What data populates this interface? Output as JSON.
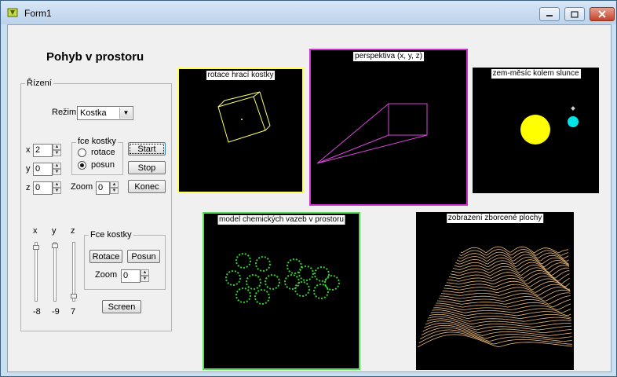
{
  "window": {
    "title": "Form1"
  },
  "heading": "Pohyb v prostoru",
  "rizeni": {
    "label": "Řízení",
    "rezim_label": "Režim",
    "rezim_value": "Kostka",
    "x_label": "x",
    "x_value": "2",
    "y_label": "y",
    "y_value": "0",
    "z_label": "z",
    "z_value": "0",
    "fce_label": "fce kostky",
    "radio_rotace": "rotace",
    "radio_posun": "posun",
    "radio_selected": "posun",
    "start_label": "Start",
    "stop_label": "Stop",
    "konec_label": "Konec",
    "zoom_label": "Zoom",
    "zoom_value": "0"
  },
  "sliders": {
    "x_label": "x",
    "y_label": "y",
    "z_label": "z",
    "x_value": "-8",
    "y_value": "-9",
    "z_value": "7"
  },
  "fce_kostky2": {
    "label": "Fce kostky",
    "rotace_label": "Rotace",
    "posun_label": "Posun",
    "zoom_label": "Zoom",
    "zoom_value": "0"
  },
  "screen_label": "Screen",
  "panels": {
    "kostka": "rotace hrací kostky",
    "perspektiva": "perspektiva (x, y, z)",
    "slunce": "zem-měsíc kolem slunce",
    "chem": "model chemických vazeb v prostoru",
    "plocha": "zobrazení zborcené plochy"
  },
  "colors": {
    "panel_bg": "#000000",
    "kostka_border": "#ffff55",
    "perspektiva_border": "#cc33cc",
    "chem_border": "#55dd55",
    "sun": "#ffff00",
    "earth": "#00e5e5",
    "surface": "#e8b87a"
  }
}
